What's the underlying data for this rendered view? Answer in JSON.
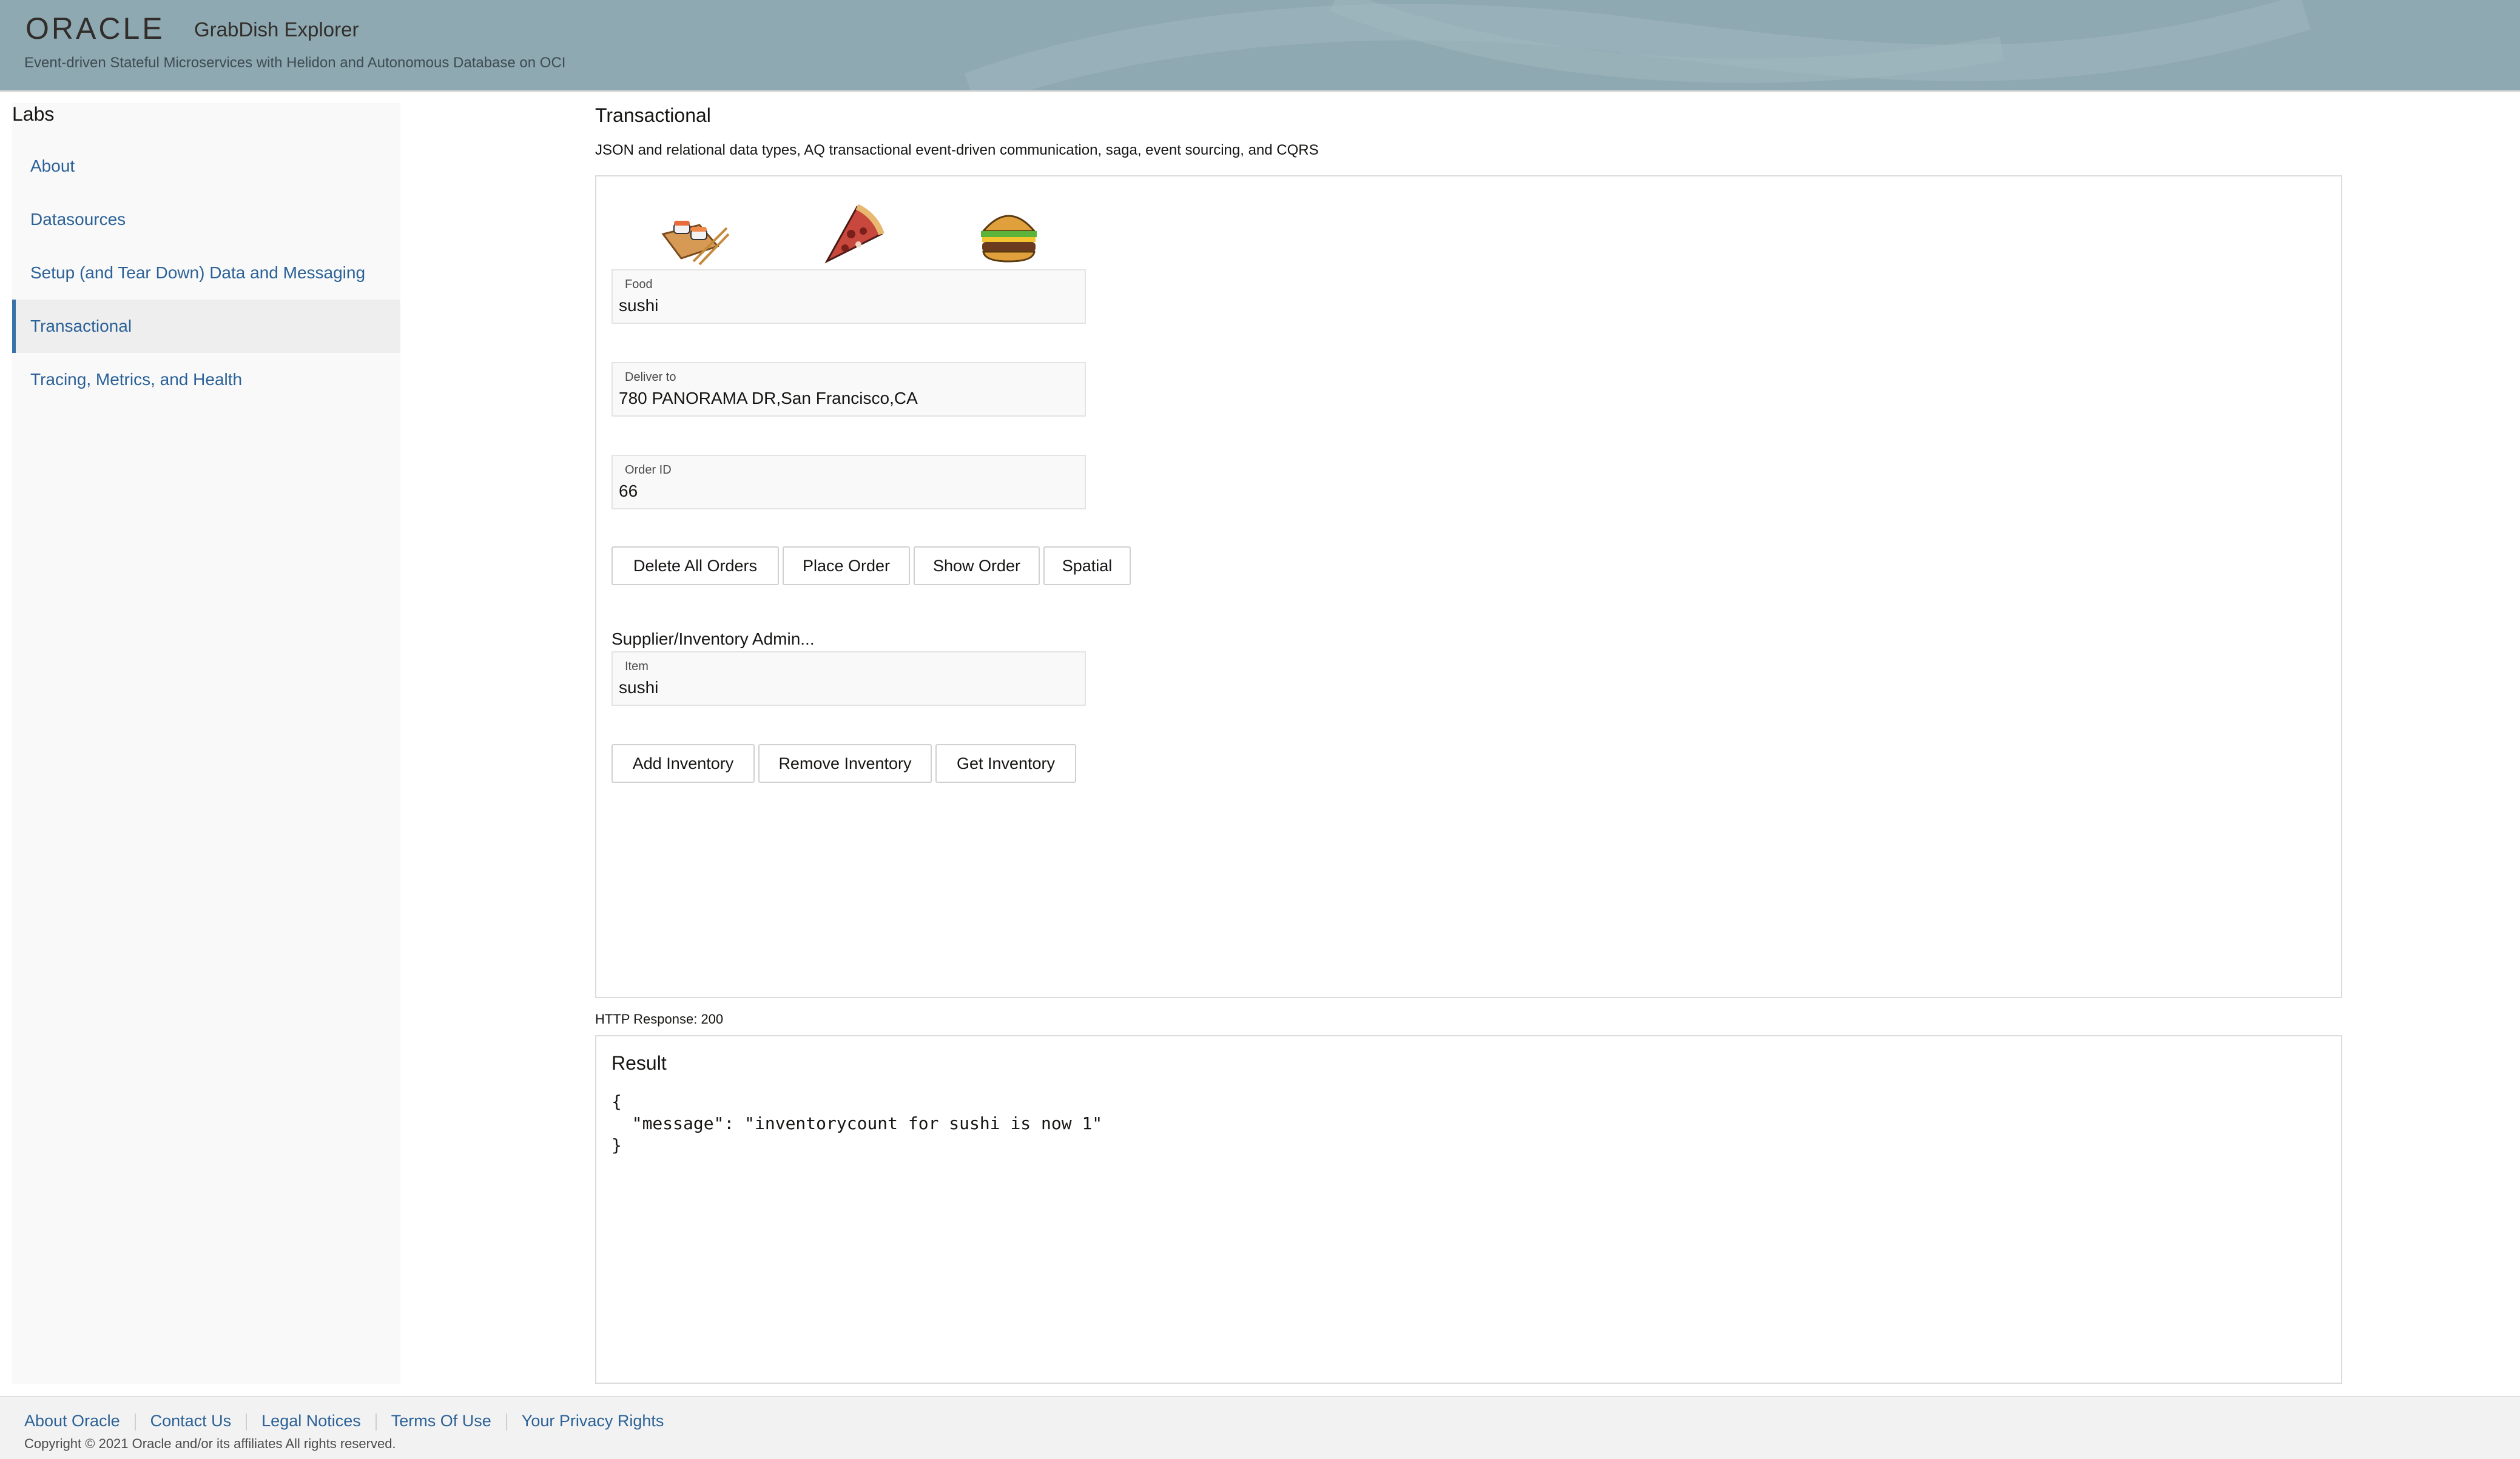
{
  "header": {
    "brand": "ORACLE",
    "app_title": "GrabDish Explorer",
    "subtitle": "Event-driven Stateful Microservices with Helidon and Autonomous Database on OCI"
  },
  "sidebar": {
    "title": "Labs",
    "items": [
      {
        "label": "About"
      },
      {
        "label": "Datasources"
      },
      {
        "label": "Setup (and Tear Down) Data and Messaging"
      },
      {
        "label": "Transactional",
        "active": true
      },
      {
        "label": "Tracing, Metrics, and Health"
      }
    ]
  },
  "main": {
    "title": "Transactional",
    "description": "JSON and relational data types, AQ transactional event-driven communication, saga, event sourcing, and CQRS",
    "food_icons": [
      "sushi-icon",
      "pizza-icon",
      "burger-icon"
    ],
    "fields": {
      "food": {
        "label": "Food",
        "value": "sushi"
      },
      "deliver_to": {
        "label": "Deliver to",
        "value": "780 PANORAMA DR,San Francisco,CA"
      },
      "order_id": {
        "label": "Order ID",
        "value": "66"
      }
    },
    "order_buttons": {
      "delete_all": "Delete All Orders",
      "place": "Place Order",
      "show": "Show Order",
      "spatial": "Spatial"
    },
    "inventory": {
      "section_label": "Supplier/Inventory Admin...",
      "item_label": "Item",
      "item_value": "sushi",
      "add": "Add Inventory",
      "remove": "Remove Inventory",
      "get": "Get Inventory"
    },
    "http_status": "HTTP Response: 200",
    "result": {
      "title": "Result",
      "body": "{\n  \"message\": \"inventorycount for sushi is now 1\"\n}"
    }
  },
  "footer": {
    "links": [
      "About Oracle",
      "Contact Us",
      "Legal Notices",
      "Terms Of Use",
      "Your Privacy Rights"
    ],
    "copyright": "Copyright © 2021 Oracle and/or its affiliates All rights reserved."
  },
  "colors": {
    "header_bg": "#8fa9b2",
    "link": "#2b6197",
    "active_indicator": "#3a71a8"
  }
}
